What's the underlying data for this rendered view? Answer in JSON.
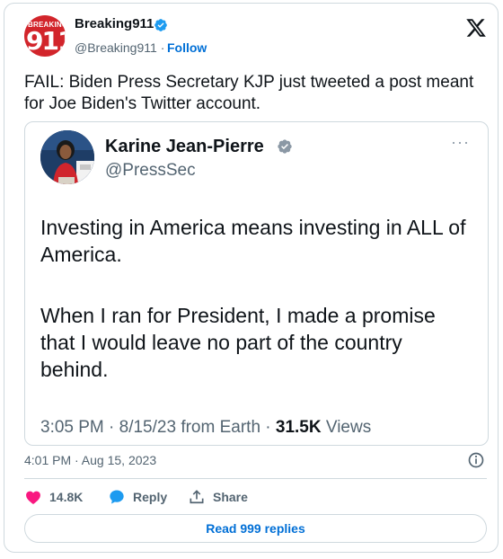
{
  "author": {
    "name": "Breaking911",
    "handle": "@Breaking911",
    "separator": "·",
    "follow_label": "Follow",
    "avatar_text_small": "BREAKING",
    "avatar_text_big": "911"
  },
  "tweet": {
    "text": "FAIL: Biden Press Secretary KJP just tweeted a post meant for Joe Biden's Twitter account.",
    "timestamp": "4:01 PM · Aug 15, 2023"
  },
  "embedded_tweet": {
    "name": "Karine Jean-Pierre",
    "handle": "@PressSec",
    "more_label": "···",
    "paragraph_1": "Investing in America means investing in ALL of\nAmerica.",
    "paragraph_2": "When I ran for President, I made a promise\nthat I would leave no part of the country\nbehind.",
    "meta_time": "3:05 PM · 8/15/23 from Earth · ",
    "views_count": "31.5K",
    "views_label": " Views"
  },
  "actions": {
    "like_count": "14.8K",
    "reply_label": "Reply",
    "share_label": "Share"
  },
  "replies": {
    "label": "Read 999 replies"
  },
  "colors": {
    "accent_blue": "#006fd6",
    "verified_blue": "#1d9bf0",
    "like_pink": "#f91880",
    "reply_blue": "#1d9bf0",
    "text_primary": "#0f1419",
    "text_secondary": "#536471",
    "border": "#cfd9de"
  },
  "icons": {
    "x": "x-logo-icon",
    "verified": "verified-badge-icon",
    "info": "info-icon",
    "like": "heart-icon",
    "reply": "speech-bubble-icon",
    "share": "share-upload-icon"
  }
}
